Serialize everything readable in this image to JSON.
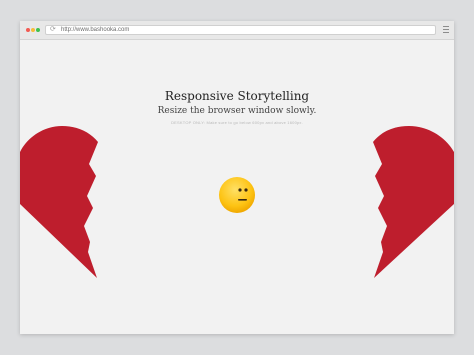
{
  "browser": {
    "url": "http://www.bashooka.com"
  },
  "page": {
    "title": "Responsive Storytelling",
    "subtitle": "Resize the browser window slowly.",
    "note": "DESKTOP ONLY: Make sure to go below 600px and above 1600px."
  },
  "icons": {
    "reload": "reload-icon",
    "menu": "hamburger-menu-icon",
    "heart": "broken-heart-half",
    "emoji": "neutral-face-emoji"
  },
  "colors": {
    "heart": "#be1e2d",
    "emoji": "#fdc313",
    "background": "#f2f2f2"
  }
}
